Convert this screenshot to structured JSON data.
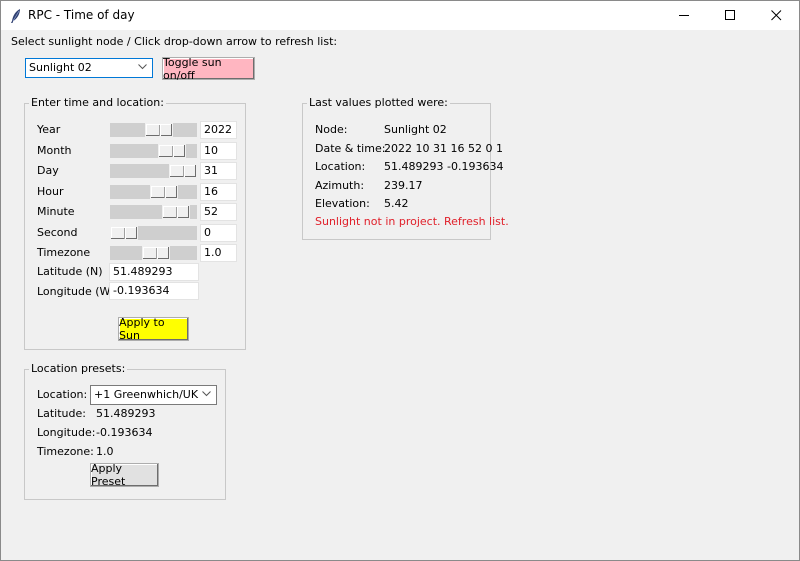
{
  "window": {
    "title": "RPC - Time of day",
    "controls": {
      "minimize": "minimize",
      "maximize": "maximize",
      "close": "close"
    }
  },
  "header": {
    "instruction": "Select sunlight node / Click drop-down arrow to refresh list:",
    "node_select_value": "Sunlight 02",
    "toggle_button": "Toggle sun on/off",
    "toggle_color": "#ffb6c1"
  },
  "time_location": {
    "title": "Enter time and location:",
    "rows": [
      {
        "label": "Year",
        "value": "2022",
        "slider_fraction": 0.6
      },
      {
        "label": "Month",
        "value": "10",
        "slider_fraction": 0.82
      },
      {
        "label": "Day",
        "value": "31",
        "slider_fraction": 1.0
      },
      {
        "label": "Hour",
        "value": "16",
        "slider_fraction": 0.68
      },
      {
        "label": "Minute",
        "value": "52",
        "slider_fraction": 0.88
      },
      {
        "label": "Second",
        "value": "0",
        "slider_fraction": 0.0
      },
      {
        "label": "Timezone",
        "value": "1.0",
        "slider_fraction": 0.55
      }
    ],
    "latitude_label": "Latitude (N)",
    "latitude_value": "51.489293",
    "longitude_label": "Longitude (W)",
    "longitude_value": "-0.193634",
    "apply_button": "Apply to Sun",
    "apply_color": "#ffff00"
  },
  "last_values": {
    "title": "Last values plotted were:",
    "rows": [
      {
        "label": "Node:",
        "value": "Sunlight 02"
      },
      {
        "label": "Date & time:",
        "value": "2022 10 31 16 52 0 1"
      },
      {
        "label": "Location:",
        "value": "51.489293 -0.193634"
      },
      {
        "label": "Azimuth:",
        "value": "239.17"
      },
      {
        "label": "Elevation:",
        "value": "5.42"
      }
    ],
    "status_message": "Sunlight not in project. Refresh list.",
    "status_color": "#e0202a"
  },
  "presets": {
    "title": "Location presets:",
    "location_label": "Location:",
    "location_value": "+1 Greenwhich/UK",
    "latitude_label": "Latitude:",
    "latitude_value": "51.489293",
    "longitude_label": "Longitude:",
    "longitude_value": "-0.193634",
    "timezone_label": "Timezone:",
    "timezone_value": "1.0",
    "apply_button": "Apply Preset"
  }
}
